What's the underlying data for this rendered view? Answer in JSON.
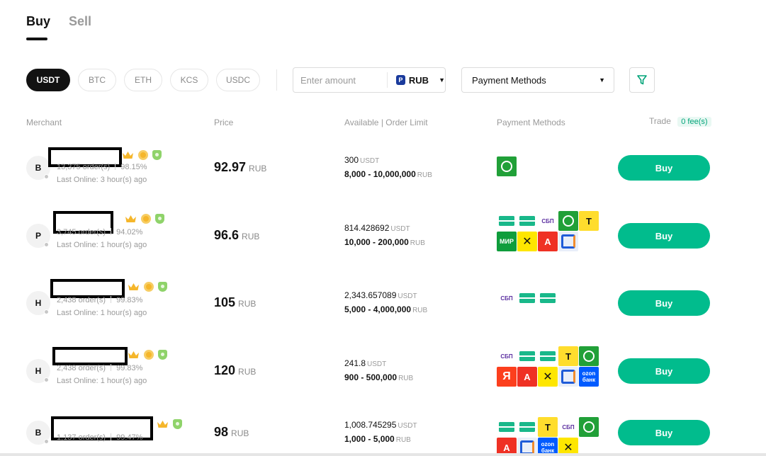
{
  "tabs": [
    {
      "label": "Buy",
      "active": true
    },
    {
      "label": "Sell",
      "active": false
    }
  ],
  "coins": [
    "USDT",
    "BTC",
    "ETH",
    "KCS",
    "USDC"
  ],
  "selected_coin": "USDT",
  "amount": {
    "placeholder": "Enter amount",
    "currency": "RUB",
    "currency_icon": "P"
  },
  "payment_methods_select": {
    "label": "Payment Methods"
  },
  "columns": {
    "merchant": "Merchant",
    "price": "Price",
    "available": "Available | Order Limit",
    "payment_methods": "Payment Methods",
    "trade": "Trade",
    "fee_badge": "0 fee(s)"
  },
  "rows": [
    {
      "initial": "B",
      "orders": "13,375 order(s)",
      "completion": "98.15%",
      "last_online": "Last Online: 3 hour(s) ago",
      "price": "92.97",
      "price_currency": "RUB",
      "available": "300",
      "available_unit": "USDT",
      "limit": "8,000 - 10,000,000",
      "limit_unit": "RUB",
      "methods": [
        "sber"
      ],
      "action": "Buy"
    },
    {
      "initial": "P",
      "orders": "3,745 order(s)",
      "completion": "94.02%",
      "last_online": "Last Online: 1 hour(s) ago",
      "price": "96.6",
      "price_currency": "RUB",
      "available": "814.428692",
      "available_unit": "USDT",
      "limit": "10,000 - 200,000",
      "limit_unit": "RUB",
      "methods": [
        "card",
        "card",
        "sbp",
        "sber",
        "tink",
        "mir",
        "raif",
        "alfa",
        "vtb"
      ],
      "action": "Buy"
    },
    {
      "initial": "H",
      "orders": "2,438 order(s)",
      "completion": "99.83%",
      "last_online": "Last Online: 1 hour(s) ago",
      "price": "105",
      "price_currency": "RUB",
      "available": "2,343.657089",
      "available_unit": "USDT",
      "limit": "5,000 - 4,000,000",
      "limit_unit": "RUB",
      "methods": [
        "sbp",
        "card",
        "card"
      ],
      "action": "Buy"
    },
    {
      "initial": "H",
      "orders": "2,438 order(s)",
      "completion": "99.83%",
      "last_online": "Last Online: 1 hour(s) ago",
      "price": "120",
      "price_currency": "RUB",
      "available": "241.8",
      "available_unit": "USDT",
      "limit": "900 - 500,000",
      "limit_unit": "RUB",
      "methods": [
        "sbp",
        "card",
        "card",
        "tink",
        "sber",
        "yandex",
        "alfa",
        "raif",
        "vtb",
        "ozon"
      ],
      "action": "Buy"
    },
    {
      "initial": "B",
      "orders": "1,137 order(s)",
      "completion": "99.47%",
      "last_online": "",
      "price": "98",
      "price_currency": "RUB",
      "available": "1,008.745295",
      "available_unit": "USDT",
      "limit": "1,000 - 5,000",
      "limit_unit": "RUB",
      "methods": [
        "card",
        "card",
        "tink",
        "sbp",
        "sber",
        "alfa",
        "vtb",
        "ozon",
        "raif"
      ],
      "action": "Buy"
    }
  ],
  "method_glyphs": {
    "card": "",
    "sber": "",
    "tink": "T",
    "mir": "МИР",
    "raif": "✕",
    "alfa": "А",
    "vtb": "",
    "sbp": "СБП",
    "yandex": "Я",
    "ozon": "ozon банк"
  },
  "colors": {
    "accent": "#01bc8d",
    "text": "#121212",
    "muted": "#9a9a9a"
  }
}
